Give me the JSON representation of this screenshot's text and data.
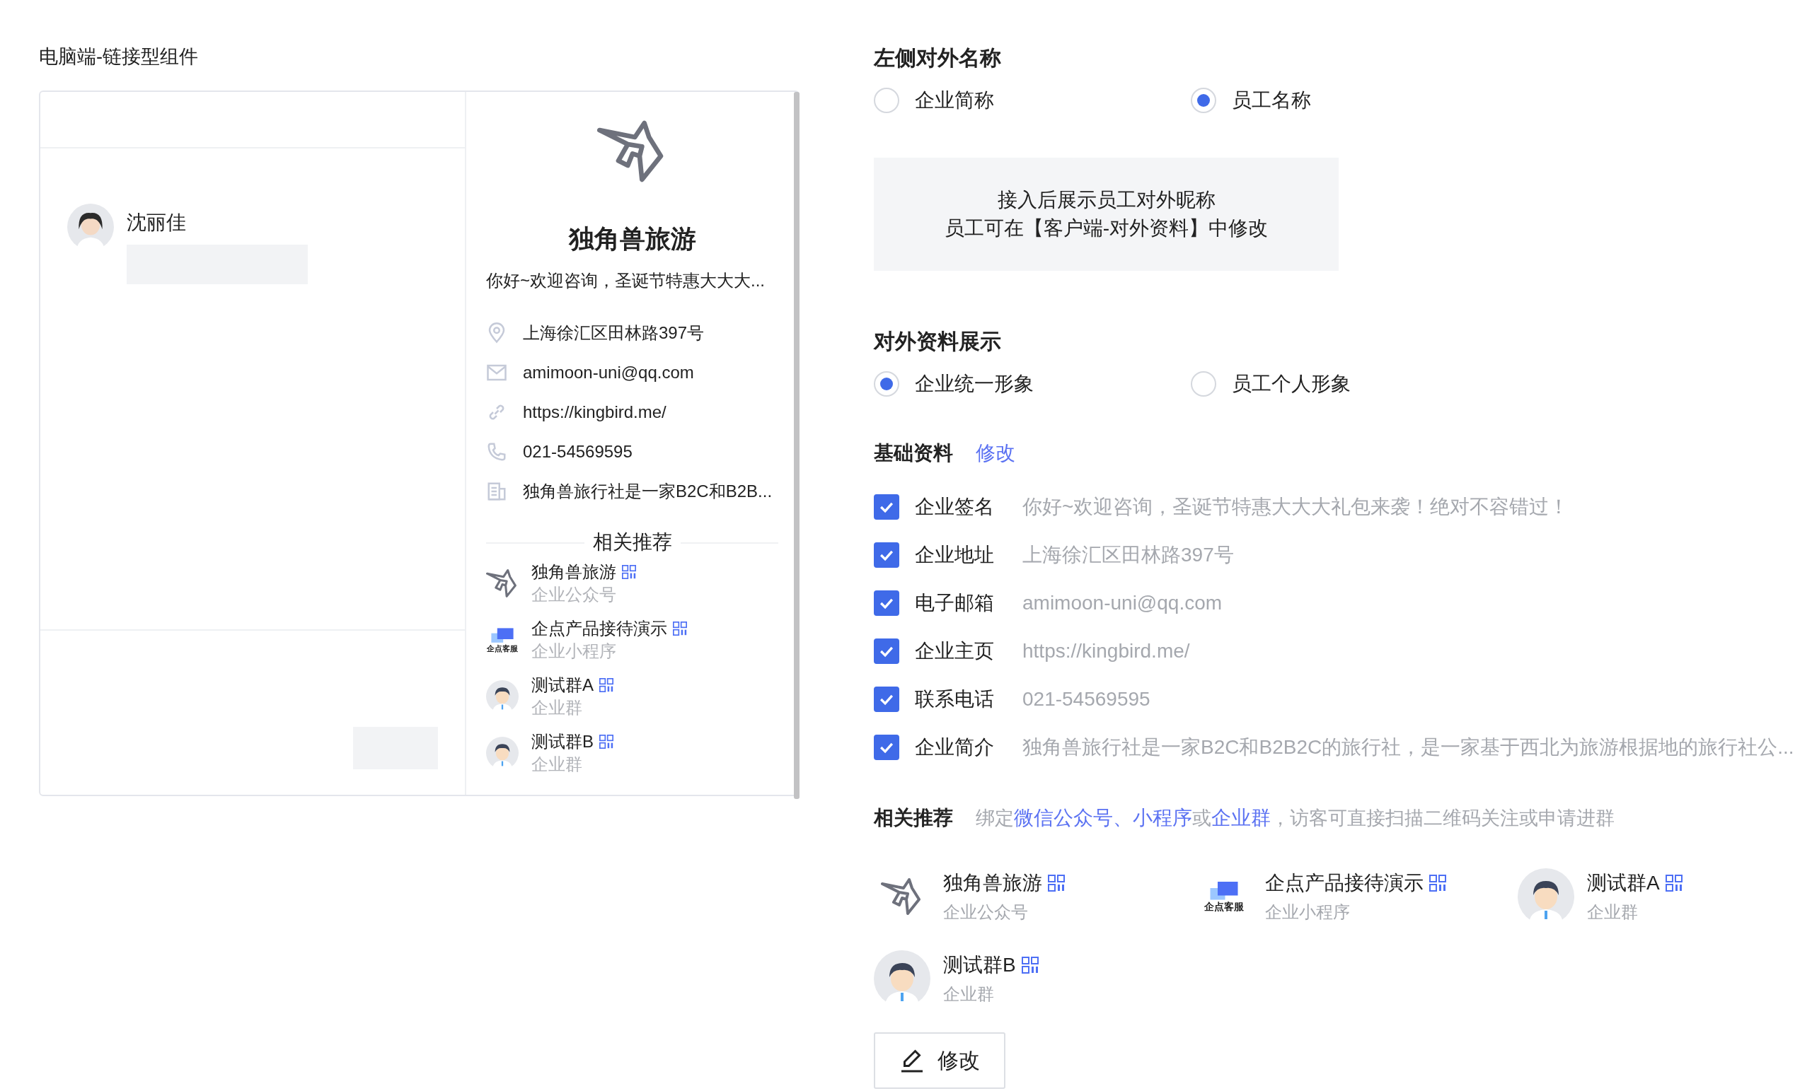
{
  "preview": {
    "title": "电脑端-链接型组件",
    "chat": {
      "name": "沈丽佳"
    },
    "card": {
      "company": "独角兽旅游",
      "signature": "你好~欢迎咨询，圣诞节特惠大大大...",
      "details": [
        {
          "kind": "location",
          "text": "上海徐汇区田林路397号"
        },
        {
          "kind": "mail",
          "text": "amimoon-uni@qq.com"
        },
        {
          "kind": "link",
          "text": "https://kingbird.me/"
        },
        {
          "kind": "phone",
          "text": "021-54569595"
        },
        {
          "kind": "doc",
          "text": "独角兽旅行社是一家B2C和B2B..."
        }
      ],
      "related_title": "相关推荐",
      "related": [
        {
          "kind": "unicorn",
          "name": "独角兽旅游",
          "type": "企业公众号"
        },
        {
          "kind": "service",
          "name": "企点产品接待演示",
          "type": "企业小程序",
          "logo_text": "企点客服"
        },
        {
          "kind": "group",
          "name": "测试群A",
          "type": "企业群"
        },
        {
          "kind": "group",
          "name": "测试群B",
          "type": "企业群"
        }
      ]
    }
  },
  "settings": {
    "display_name": {
      "title": "左侧对外名称",
      "options": [
        {
          "label": "企业简称",
          "selected": false
        },
        {
          "label": "员工名称",
          "selected": true
        }
      ]
    },
    "note": [
      "接入后展示员工对外昵称",
      "员工可在【客户端-对外资料】中修改"
    ],
    "profile": {
      "title": "对外资料展示",
      "options": [
        {
          "label": "企业统一形象",
          "selected": true
        },
        {
          "label": "员工个人形象",
          "selected": false
        }
      ]
    },
    "basic": {
      "title": "基础资料",
      "edit": "修改",
      "fields": [
        {
          "label": "企业签名",
          "value": "你好~欢迎咨询，圣诞节特惠大大大礼包来袭！绝对不容错过！",
          "checked": true
        },
        {
          "label": "企业地址",
          "value": "上海徐汇区田林路397号",
          "checked": true
        },
        {
          "label": "电子邮箱",
          "value": "amimoon-uni@qq.com",
          "checked": true
        },
        {
          "label": "企业主页",
          "value": "https://kingbird.me/",
          "checked": true
        },
        {
          "label": "联系电话",
          "value": "021-54569595",
          "checked": true
        },
        {
          "label": "企业简介",
          "value": "独角兽旅行社是一家B2C和B2B2C的旅行社，是一家基于西北为旅游根据地的旅行社公...",
          "checked": true
        }
      ]
    },
    "related": {
      "title": "相关推荐",
      "description": [
        {
          "text": "绑定",
          "link": false
        },
        {
          "text": "微信公众号、",
          "link": true
        },
        {
          "text": "小程序",
          "link": true
        },
        {
          "text": "或",
          "link": false
        },
        {
          "text": "企业群",
          "link": true
        },
        {
          "text": "，访客可直接扫描二维码关注或申请进群",
          "link": false
        }
      ],
      "items": [
        {
          "kind": "unicorn",
          "name": "独角兽旅游",
          "type": "企业公众号"
        },
        {
          "kind": "service",
          "name": "企点产品接待演示",
          "type": "企业小程序",
          "logo_text": "企点客服"
        },
        {
          "kind": "group",
          "name": "测试群A",
          "type": "企业群"
        },
        {
          "kind": "group",
          "name": "测试群B",
          "type": "企业群"
        }
      ]
    },
    "edit_button": "修改"
  }
}
